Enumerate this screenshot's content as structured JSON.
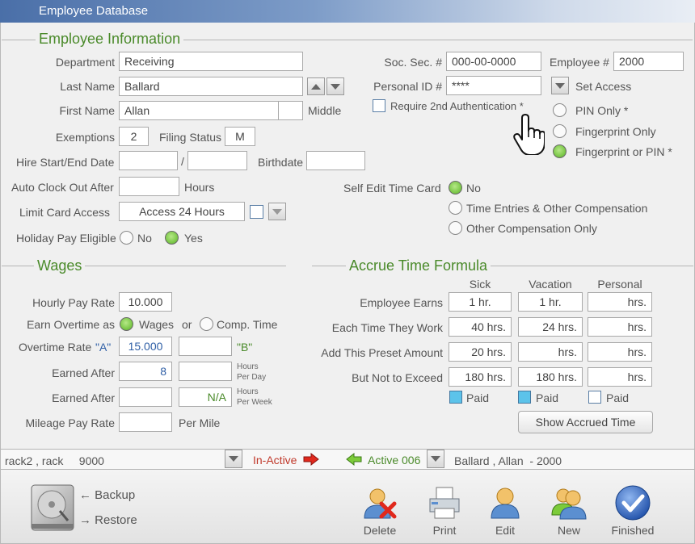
{
  "window": {
    "title": "Employee Database"
  },
  "sections": {
    "employee_info": "Employee Information",
    "wages": "Wages",
    "accrue": "Accrue Time Formula"
  },
  "employee": {
    "department_label": "Department",
    "department": "Receiving",
    "last_name_label": "Last Name",
    "last_name": "Ballard",
    "first_name_label": "First Name",
    "first_name": "Allan",
    "middle_label": "Middle",
    "middle": "",
    "exemptions_label": "Exemptions",
    "exemptions": "2",
    "filing_status_label": "Filing Status",
    "filing_status": "M",
    "hire_label": "Hire Start/End Date",
    "hire_start": "",
    "hire_sep": "/",
    "hire_end": "",
    "birthdate_label": "Birthdate",
    "birthdate": "",
    "auto_clock_label": "Auto Clock Out After",
    "auto_clock": "",
    "hours_label": "Hours",
    "limit_card_label": "Limit Card Access",
    "limit_card": "Access 24 Hours",
    "holiday_label": "Holiday Pay Eligible",
    "holiday_no": "No",
    "holiday_yes": "Yes",
    "ssn_label": "Soc. Sec. #",
    "ssn": "000-00-0000",
    "emp_num_label": "Employee #",
    "emp_num": "2000",
    "pid_label": "Personal ID #",
    "pid": "****",
    "set_access": "Set Access",
    "require_2nd": "Require 2nd Authentication *",
    "auth_options": [
      "PIN Only *",
      "Fingerprint Only",
      "Fingerprint or PIN *"
    ],
    "auth_selected": 2,
    "self_edit_label": "Self Edit Time Card",
    "self_edit_options": [
      "No",
      "Time Entries & Other Compensation",
      "Other Compensation Only"
    ],
    "self_edit_selected": 0
  },
  "wages": {
    "hourly_label": "Hourly Pay Rate",
    "hourly": "10.000",
    "overtime_as_label": "Earn Overtime as",
    "overtime_wages": "Wages",
    "overtime_or": "or",
    "overtime_comp": "Comp. Time",
    "ot_rate_label": "Overtime Rate",
    "ot_a": "\"A\"",
    "ot_rate_a": "15.000",
    "ot_rate_b": "",
    "ot_b": "\"B\"",
    "earned_after_label": "Earned After",
    "earned_after_day": "8",
    "earned_after_day2": "",
    "hours_per_day": "Hours",
    "per_day": "Per Day",
    "earned_after_label2": "Earned After",
    "earned_after_week": "",
    "earned_after_week2": "N/A",
    "hours_per_week": "Hours",
    "per_week": "Per Week",
    "mileage_label": "Mileage Pay Rate",
    "mileage": "",
    "per_mile": "Per Mile"
  },
  "accrue": {
    "columns": [
      "Sick",
      "Vacation",
      "Personal"
    ],
    "rows": [
      {
        "label": "Employee Earns",
        "values": [
          "1 hr.",
          "1 hr.",
          "hrs."
        ]
      },
      {
        "label": "Each Time They Work",
        "values": [
          "40 hrs.",
          "24 hrs.",
          "hrs."
        ]
      },
      {
        "label": "Add This Preset Amount",
        "values": [
          "20 hrs.",
          "hrs.",
          "hrs."
        ]
      },
      {
        "label": "But Not to Exceed",
        "values": [
          "180 hrs.",
          "180 hrs.",
          "hrs."
        ]
      }
    ],
    "paid_label": "Paid",
    "paid": [
      true,
      true,
      false
    ],
    "show_accrued": "Show Accrued Time"
  },
  "status": {
    "left_value": "rack2 , rack     9000",
    "inactive": "In-Active",
    "active": "Active 006",
    "right_value": "Ballard , Allan  - 2000"
  },
  "footer": {
    "backup": "Backup",
    "restore": "Restore",
    "tools": [
      "Delete",
      "Print",
      "Edit",
      "New",
      "Finished"
    ]
  },
  "colors": {
    "accent_green": "#4a8a2a",
    "label_blue": "#2f5fa6",
    "radio_on": "#7dc94a",
    "checkbox_on": "#5cc3ea",
    "inactive_red": "#c0392b"
  }
}
